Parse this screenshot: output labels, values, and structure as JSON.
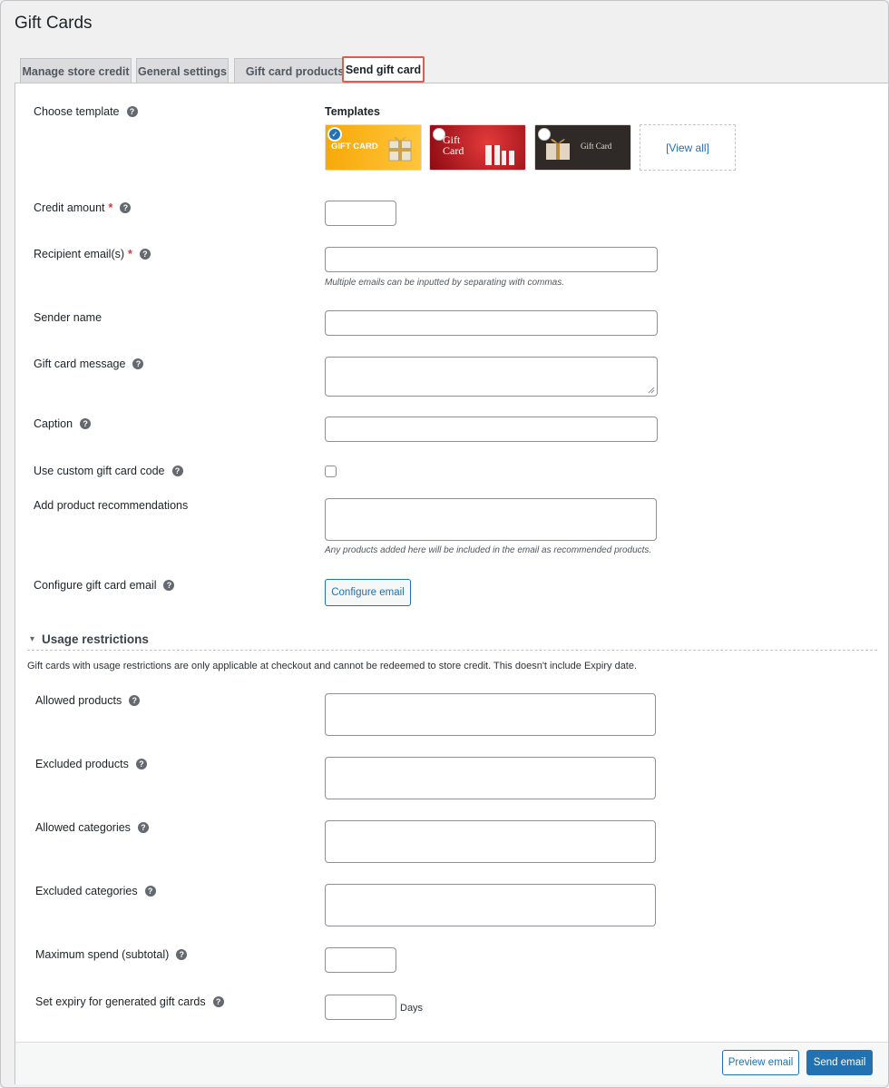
{
  "page": {
    "title": "Gift Cards"
  },
  "tabs": [
    {
      "label": "Manage store credit"
    },
    {
      "label": "General settings"
    },
    {
      "label": "Gift card products"
    },
    {
      "label": "Send gift card",
      "active": true
    }
  ],
  "form": {
    "choose_template": {
      "label": "Choose template"
    },
    "templates": {
      "title": "Templates",
      "items": [
        {
          "text": "GIFT CARD",
          "selected": true,
          "color": "#f9b60b"
        },
        {
          "text": "Gift Card",
          "selected": false,
          "color": "#b4121b"
        },
        {
          "text": "Gift Card",
          "selected": false,
          "color": "#2e2a27"
        }
      ],
      "view_all": "[View all]"
    },
    "credit_amount": {
      "label": "Credit amount",
      "required": "*",
      "value": ""
    },
    "recipient_emails": {
      "label": "Recipient email(s)",
      "required": "*",
      "value": "",
      "hint": "Multiple emails can be inputted by separating with commas."
    },
    "sender_name": {
      "label": "Sender name",
      "value": ""
    },
    "gift_card_message": {
      "label": "Gift card message",
      "value": ""
    },
    "caption": {
      "label": "Caption",
      "value": ""
    },
    "custom_code": {
      "label": "Use custom gift card code",
      "checked": false
    },
    "product_recommendations": {
      "label": "Add product recommendations",
      "hint": "Any products added here will be included in the email as recommended products."
    },
    "configure_email": {
      "label": "Configure gift card email",
      "button": "Configure email"
    }
  },
  "usage_restrictions": {
    "title": "Usage restrictions",
    "description": "Gift cards with usage restrictions are only applicable at checkout and cannot be redeemed to store credit. This doesn't include Expiry date.",
    "allowed_products": {
      "label": "Allowed products"
    },
    "excluded_products": {
      "label": "Excluded products"
    },
    "allowed_categories": {
      "label": "Allowed categories"
    },
    "excluded_categories": {
      "label": "Excluded categories"
    },
    "maximum_spend": {
      "label": "Maximum spend (subtotal)",
      "value": ""
    },
    "expiry": {
      "label": "Set expiry for generated gift cards",
      "value": "",
      "unit": "Days"
    }
  },
  "footer": {
    "preview_button": "Preview email",
    "send_button": "Send email"
  },
  "icons": {
    "help": "?",
    "collapse": "▾",
    "check": "✓"
  },
  "colors": {
    "accent": "#2271b1",
    "required": "#d63638",
    "tab_highlight": "#e35b4e"
  }
}
